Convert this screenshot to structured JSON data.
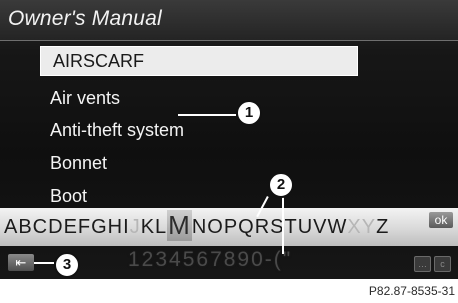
{
  "header": {
    "title": "Owner's Manual"
  },
  "search": {
    "value": "AIRSCARF"
  },
  "results": {
    "items": [
      "Air vents",
      "Anti-theft system",
      "Bonnet",
      "Boot"
    ]
  },
  "keyboard": {
    "row_before_selected": "ABCDEFGHI",
    "dim_j": "J",
    "row_kl": "KL",
    "selected_letter": "M",
    "row_after_selected": "NOPQRSTUVW",
    "dim_xy": "XY",
    "row_z": "Z",
    "ok_label": "ok",
    "numeric_row": "1234567890-(\""
  },
  "controls": {
    "back_glyph": "⇤",
    "ctl_left_glyph": "…",
    "ctl_right_glyph": "c"
  },
  "callouts": {
    "c1": "1",
    "c2": "2",
    "c3": "3"
  },
  "caption": "P82.87-8535-31",
  "colors": {
    "screen_bg": "#111111",
    "keyboard_band": "#d9d9d9",
    "text_light": "#f4f4f4"
  }
}
